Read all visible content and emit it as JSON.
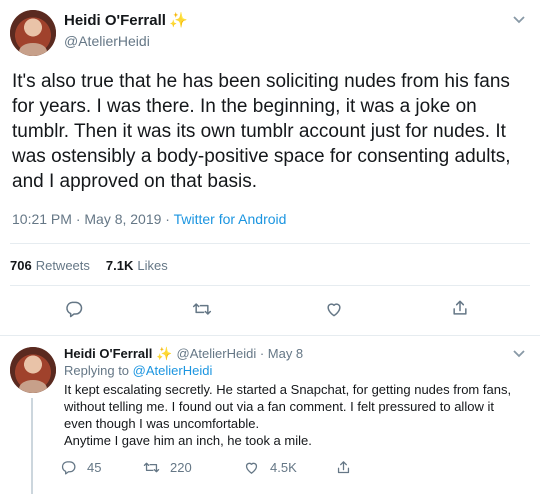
{
  "main_tweet": {
    "display_name": "Heidi O'Ferrall",
    "verified_emoji": "✨",
    "handle": "@AtelierHeidi",
    "text": "It's also true that he has been soliciting nudes from his fans for years. I was there. In the beginning, it was a joke on tumblr. Then it was its own tumblr account just for nudes. It was ostensibly a body-positive space for consenting adults, and I approved on that basis.",
    "timestamp": "10:21 PM · May 8, 2019 · ",
    "client": "Twitter for Android",
    "retweets_count": "706",
    "retweets_label": "Retweets",
    "likes_count": "7.1K",
    "likes_label": "Likes"
  },
  "reply_tweet": {
    "display_name": "Heidi O'Ferrall",
    "verified_emoji": "✨",
    "handle_date": "@AtelierHeidi · May 8",
    "replying_prefix": "Replying to ",
    "replying_handle": "@AtelierHeidi",
    "text_lines": [
      "It kept escalating secretly. He started a Snapchat, for getting nudes from fans,",
      "without telling me. I found out via a fan comment. I felt pressured to allow it",
      "even though I was uncomfortable.",
      "Anytime I gave him an inch, he took a mile."
    ],
    "replies_count": "45",
    "retweets_count": "220",
    "likes_count": "4.5K"
  },
  "icons": {
    "reply": "reply-icon",
    "retweet": "retweet-icon",
    "like": "heart-icon",
    "share": "share-icon",
    "caret": "chevron-down-icon"
  },
  "colors": {
    "link": "#1b95e0",
    "secondary_text": "#657786",
    "divider": "#e6ecf0"
  }
}
